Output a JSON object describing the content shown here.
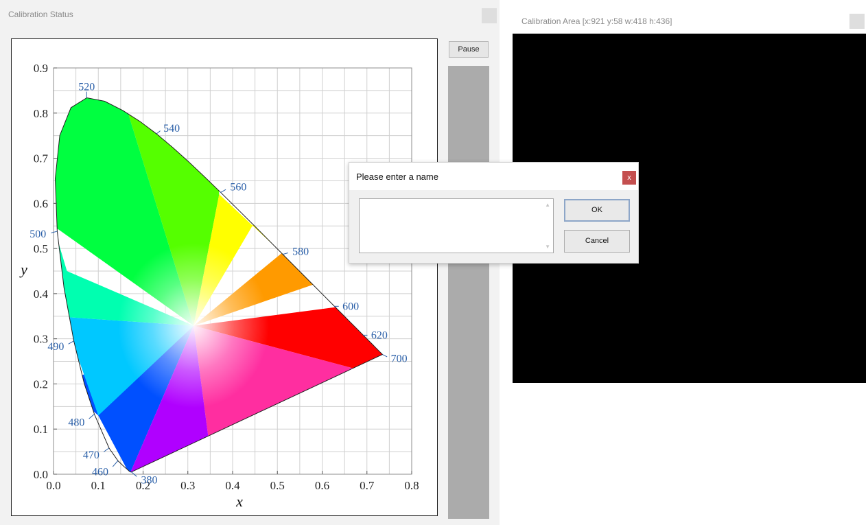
{
  "status_panel": {
    "title": "Calibration Status",
    "pause_label": "Pause"
  },
  "area_panel": {
    "title": "Calibration Area [x:921 y:58 w:418 h:436]"
  },
  "dialog": {
    "title": "Please enter a name",
    "close_label": "x",
    "name_value": "",
    "ok_label": "OK",
    "cancel_label": "Cancel"
  },
  "chart_data": {
    "type": "scatter",
    "title": "",
    "xlabel": "x",
    "ylabel": "y",
    "xlim": [
      0.0,
      0.8
    ],
    "ylim": [
      0.0,
      0.9
    ],
    "xticks": [
      "0.0",
      "0.1",
      "0.2",
      "0.3",
      "0.4",
      "0.5",
      "0.6",
      "0.7",
      "0.8"
    ],
    "yticks": [
      "0.0",
      "0.1",
      "0.2",
      "0.3",
      "0.4",
      "0.5",
      "0.6",
      "0.7",
      "0.8",
      "0.9"
    ],
    "grid": true,
    "wavelength_labels": [
      {
        "nm": "520",
        "x": 0.074,
        "y": 0.834
      },
      {
        "nm": "540",
        "x": 0.23,
        "y": 0.754
      },
      {
        "nm": "560",
        "x": 0.373,
        "y": 0.624
      },
      {
        "nm": "580",
        "x": 0.512,
        "y": 0.487
      },
      {
        "nm": "600",
        "x": 0.627,
        "y": 0.372
      },
      {
        "nm": "620",
        "x": 0.691,
        "y": 0.308
      },
      {
        "nm": "700",
        "x": 0.735,
        "y": 0.265
      },
      {
        "nm": "500",
        "x": 0.008,
        "y": 0.538
      },
      {
        "nm": "490",
        "x": 0.045,
        "y": 0.295
      },
      {
        "nm": "480",
        "x": 0.091,
        "y": 0.133
      },
      {
        "nm": "470",
        "x": 0.124,
        "y": 0.058
      },
      {
        "nm": "460",
        "x": 0.144,
        "y": 0.03
      },
      {
        "nm": "380",
        "x": 0.174,
        "y": 0.005
      }
    ]
  }
}
